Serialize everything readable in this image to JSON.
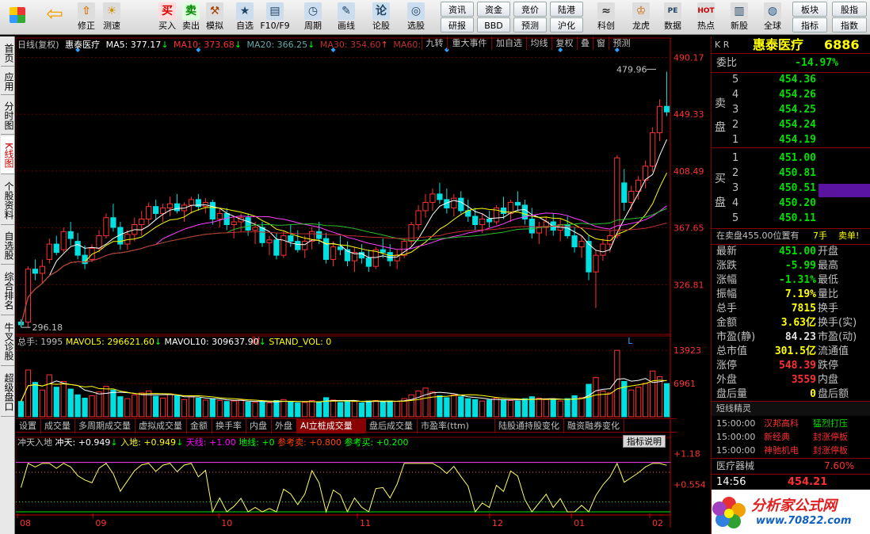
{
  "toolbar": {
    "items": [
      {
        "label": "修正",
        "icon": "⇧"
      },
      {
        "label": "测速",
        "icon": "☀"
      },
      {
        "label": "买入",
        "icon": "买"
      },
      {
        "label": "卖出",
        "icon": "卖"
      },
      {
        "label": "模拟",
        "icon": "⚒"
      },
      {
        "label": "自选",
        "icon": "★"
      },
      {
        "label": "F10/F9",
        "icon": "▤"
      },
      {
        "label": "周期",
        "icon": "◷"
      },
      {
        "label": "画线",
        "icon": "✎"
      },
      {
        "label": "论股",
        "icon": "论"
      },
      {
        "label": "选股",
        "icon": "◎"
      },
      {
        "label": "科创",
        "icon": "≈"
      },
      {
        "label": "龙虎",
        "icon": "♔"
      },
      {
        "label": "数据",
        "icon": "PE"
      },
      {
        "label": "热点",
        "icon": "HOT"
      },
      {
        "label": "新股",
        "icon": "▥"
      },
      {
        "label": "全球",
        "icon": "◍"
      }
    ],
    "buttons": [
      "资讯",
      "资金",
      "竞价",
      "陆港",
      "研报",
      "BBD",
      "预测",
      "沪化"
    ],
    "right": [
      "板块",
      "股指",
      "指标",
      "指数"
    ]
  },
  "left_tabs": [
    "首页",
    "应用",
    "分时图",
    "K线图",
    "个股资料",
    "自选股",
    "综合排名",
    "牛叉诊股",
    "超级盘口"
  ],
  "chart": {
    "header": {
      "period": "日线(复权)",
      "name": "惠泰医疗",
      "ma5": "MA5: 377.17",
      "ma10": "MA10: 373.68",
      "ma20": "MA20: 366.25",
      "ma30": "MA30: 354.60",
      "ma60": "MA60:"
    },
    "header_buttons": [
      "九转",
      "重大事件",
      "加自选",
      "均线",
      "复权",
      "叠",
      "窗",
      "预测"
    ],
    "price_ticks": [
      "490.17",
      "449.33",
      "408.49",
      "367.65",
      "326.81"
    ],
    "hi_label": "479.96",
    "lo_label": "296.18",
    "markers": [
      "财",
      "L"
    ],
    "vol_header": {
      "total": "总手: 1995",
      "mavol5": "MAVOL5: 296621.60",
      "mavol10": "MAVOL10: 309637.90",
      "stand": "STAND_VOL: 0"
    },
    "vol_ticks": [
      "13923",
      "6961"
    ],
    "tabs": [
      "设置",
      "成交量",
      "多周期成交量",
      "虚拟成交量",
      "金额",
      "换手率",
      "内盘",
      "外盘",
      "AI立桩成交量",
      "盘后成交量",
      "市盈率(ttm)",
      "陆股通持股变化",
      "融资融券变化"
    ],
    "ind_header": {
      "name": "冲天入地",
      "ct": "冲天: +0.949",
      "rd": "入地: +0.949",
      "tx": "天线: +1.00",
      "dx": "地线: +0",
      "ckm": "参考卖: +0.800",
      "ckb": "参考买: +0.200"
    },
    "ind_button": "指标说明",
    "ind_ticks": [
      "+1.18",
      "+0.554"
    ],
    "months": [
      "08",
      "09",
      "10",
      "11",
      "12",
      "01",
      "02"
    ]
  },
  "chart_data": {
    "type": "candlestick",
    "ylim": [
      290,
      495
    ],
    "ohlc": [
      [
        300,
        302,
        296.18,
        298
      ],
      [
        300,
        340,
        296,
        338
      ],
      [
        338,
        345,
        330,
        335
      ],
      [
        335,
        345,
        328,
        340
      ],
      [
        345,
        360,
        342,
        356
      ],
      [
        356,
        362,
        348,
        350
      ],
      [
        352,
        368,
        350,
        365
      ],
      [
        365,
        372,
        355,
        360
      ],
      [
        358,
        364,
        345,
        348
      ],
      [
        348,
        355,
        338,
        342
      ],
      [
        345,
        356,
        343,
        353
      ],
      [
        353,
        366,
        350,
        362
      ],
      [
        362,
        378,
        360,
        375
      ],
      [
        375,
        385,
        365,
        368
      ],
      [
        368,
        372,
        352,
        356
      ],
      [
        356,
        366,
        352,
        363
      ],
      [
        363,
        375,
        358,
        370
      ],
      [
        370,
        380,
        362,
        374
      ],
      [
        374,
        386,
        370,
        383
      ],
      [
        383,
        388,
        374,
        378
      ],
      [
        378,
        385,
        372,
        382
      ],
      [
        382,
        390,
        376,
        385
      ],
      [
        385,
        392,
        378,
        380
      ],
      [
        380,
        386,
        372,
        384
      ],
      [
        384,
        390,
        378,
        388
      ],
      [
        388,
        392,
        380,
        383
      ],
      [
        383,
        389,
        378,
        386
      ],
      [
        386,
        388,
        370,
        374
      ],
      [
        374,
        382,
        368,
        378
      ],
      [
        378,
        382,
        366,
        370
      ],
      [
        370,
        376,
        360,
        372
      ],
      [
        372,
        378,
        365,
        375
      ],
      [
        375,
        378,
        362,
        366
      ],
      [
        366,
        372,
        356,
        368
      ],
      [
        368,
        372,
        354,
        357
      ],
      [
        357,
        362,
        348,
        359
      ],
      [
        359,
        364,
        345,
        348
      ],
      [
        348,
        365,
        346,
        362
      ],
      [
        362,
        370,
        354,
        358
      ],
      [
        358,
        366,
        350,
        352
      ],
      [
        352,
        362,
        346,
        358
      ],
      [
        358,
        368,
        352,
        365
      ],
      [
        365,
        372,
        356,
        360
      ],
      [
        360,
        364,
        342,
        345
      ],
      [
        345,
        358,
        340,
        354
      ],
      [
        354,
        362,
        348,
        352
      ],
      [
        352,
        358,
        340,
        344
      ],
      [
        344,
        354,
        336,
        350
      ],
      [
        350,
        356,
        342,
        346
      ],
      [
        346,
        352,
        336,
        340
      ],
      [
        340,
        354,
        338,
        352
      ],
      [
        352,
        360,
        346,
        350
      ],
      [
        350,
        356,
        340,
        344
      ],
      [
        344,
        352,
        338,
        348
      ],
      [
        348,
        360,
        346,
        358
      ],
      [
        358,
        372,
        355,
        370
      ],
      [
        370,
        384,
        366,
        380
      ],
      [
        380,
        392,
        375,
        386
      ],
      [
        386,
        396,
        380,
        392
      ],
      [
        392,
        400,
        385,
        388
      ],
      [
        388,
        396,
        378,
        382
      ],
      [
        382,
        392,
        376,
        389
      ],
      [
        389,
        394,
        378,
        380
      ],
      [
        380,
        388,
        372,
        376
      ],
      [
        376,
        382,
        366,
        370
      ],
      [
        370,
        378,
        364,
        374
      ],
      [
        374,
        380,
        368,
        372
      ],
      [
        372,
        384,
        370,
        382
      ],
      [
        382,
        390,
        374,
        378
      ],
      [
        378,
        388,
        372,
        386
      ],
      [
        386,
        394,
        380,
        384
      ],
      [
        384,
        388,
        370,
        374
      ],
      [
        374,
        382,
        360,
        364
      ],
      [
        364,
        372,
        356,
        368
      ],
      [
        368,
        376,
        362,
        372
      ],
      [
        372,
        378,
        362,
        366
      ],
      [
        366,
        374,
        358,
        370
      ],
      [
        370,
        376,
        360,
        362
      ],
      [
        362,
        368,
        350,
        354
      ],
      [
        354,
        362,
        346,
        358
      ],
      [
        358,
        362,
        330,
        336
      ],
      [
        336,
        352,
        310,
        348
      ],
      [
        348,
        360,
        344,
        356
      ],
      [
        356,
        366,
        350,
        362
      ],
      [
        362,
        420,
        360,
        418
      ],
      [
        400,
        410,
        380,
        386
      ],
      [
        386,
        398,
        380,
        394
      ],
      [
        394,
        405,
        388,
        402
      ],
      [
        402,
        416,
        396,
        412
      ],
      [
        412,
        440,
        408,
        436
      ],
      [
        436,
        460,
        430,
        455
      ],
      [
        455,
        479.96,
        448,
        451
      ]
    ],
    "vol": [
      3200,
      9800,
      7200,
      5600,
      8800,
      6200,
      7400,
      5800,
      4600,
      3900,
      4400,
      5200,
      6400,
      5600,
      4200,
      3800,
      4600,
      5000,
      5400,
      4300,
      3900,
      4800,
      4400,
      3600,
      4200,
      3900,
      3500,
      3800,
      3400,
      3200,
      3300,
      3500,
      3100,
      3000,
      3200,
      2900,
      3400,
      3600,
      3100,
      2900,
      3000,
      3400,
      3100,
      4000,
      3500,
      3000,
      3400,
      3200,
      2900,
      3300,
      3400,
      3100,
      3300,
      3200,
      3800,
      4600,
      5400,
      6000,
      5200,
      4400,
      4000,
      4600,
      4200,
      3800,
      3600,
      3300,
      3500,
      3900,
      3600,
      3400,
      3300,
      3800,
      4200,
      3900,
      3600,
      3500,
      3300,
      3800,
      4400,
      4000,
      6800,
      8200,
      5400,
      5000,
      13923,
      7400,
      5600,
      6200,
      7000,
      9600,
      8400,
      6961
    ]
  },
  "right": {
    "code": "K R",
    "name": "惠泰医疗",
    "num": "6886",
    "webi_label": "委比",
    "webi": "-14.97%",
    "sell_label": "卖",
    "sell_label2": "盘",
    "buy_label": "买",
    "buy_label2": "盘",
    "sell": [
      {
        "n": "5",
        "p": "454.36"
      },
      {
        "n": "4",
        "p": "454.26"
      },
      {
        "n": "3",
        "p": "454.25"
      },
      {
        "n": "2",
        "p": "454.24"
      },
      {
        "n": "1",
        "p": "454.19"
      }
    ],
    "buy": [
      {
        "n": "1",
        "p": "451.00"
      },
      {
        "n": "2",
        "p": "450.81"
      },
      {
        "n": "3",
        "p": "450.51"
      },
      {
        "n": "4",
        "p": "450.20"
      },
      {
        "n": "5",
        "p": "450.11"
      }
    ],
    "notice": "在卖盘455.00位置有",
    "notice_qty": "7手",
    "notice_tag": "卖单!",
    "stats": [
      {
        "l": "最新",
        "v": "451.00",
        "c": "grn",
        "r": "开盘"
      },
      {
        "l": "涨跌",
        "v": "-5.99",
        "c": "grn",
        "r": "最高"
      },
      {
        "l": "涨幅",
        "v": "-1.31%",
        "c": "grn",
        "r": "最低"
      },
      {
        "l": "振幅",
        "v": "7.19%",
        "c": "yel",
        "r": "量比"
      },
      {
        "l": "总手",
        "v": "7815",
        "c": "yel",
        "r": "换手"
      },
      {
        "l": "金额",
        "v": "3.63亿",
        "c": "yel",
        "r": "换手(实)"
      },
      {
        "l": "市盈(静)",
        "v": "84.23",
        "c": "wht",
        "r": "市盈(动)"
      },
      {
        "l": "总市值",
        "v": "301.5亿",
        "c": "yel",
        "r": "流通值"
      },
      {
        "l": "涨停",
        "v": "548.39",
        "c": "red",
        "r": "跌停"
      },
      {
        "l": "外盘",
        "v": "3559",
        "c": "red",
        "r": "内盘"
      },
      {
        "l": "盘后量",
        "v": "0",
        "c": "yel",
        "r": "盘后额"
      }
    ],
    "short_title": "短线精灵",
    "short": [
      {
        "t": "15:00:00",
        "n": "汉邦高科",
        "e": "猛烈打压"
      },
      {
        "t": "15:00:00",
        "n": "新经典",
        "e": "封涨停板"
      },
      {
        "t": "15:00:00",
        "n": "神驰机电",
        "e": "封涨停板"
      }
    ],
    "sector": "医疗器械",
    "sector_pct": "7.60%",
    "tick_time": "14:56",
    "tick_price": "454.21",
    "logo": "分析家公式网",
    "logo_url": "www.70822.com"
  }
}
